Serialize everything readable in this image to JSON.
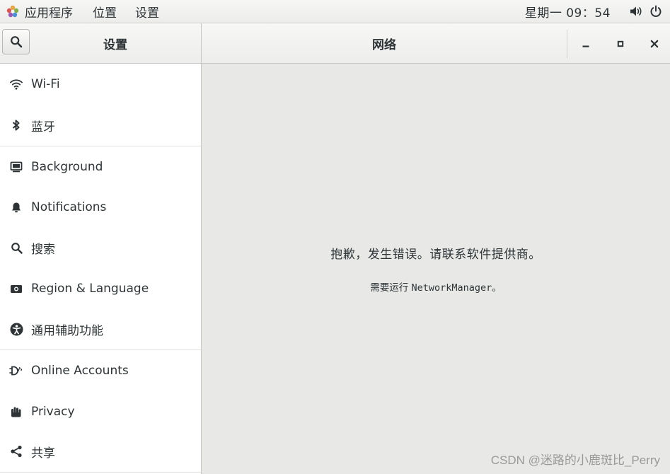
{
  "topbar": {
    "menus": [
      {
        "label": "应用程序"
      },
      {
        "label": "位置"
      },
      {
        "label": "设置"
      }
    ],
    "clock": "星期一 09：54"
  },
  "header": {
    "left_title": "设置",
    "center_title": "网络"
  },
  "sidebar": {
    "items": [
      {
        "label": "Wi-Fi",
        "icon": "wifi-icon"
      },
      {
        "label": "蓝牙",
        "icon": "bluetooth-icon"
      },
      {
        "label": "Background",
        "icon": "background-icon"
      },
      {
        "label": "Notifications",
        "icon": "bell-icon"
      },
      {
        "label": "搜索",
        "icon": "search-icon"
      },
      {
        "label": "Region & Language",
        "icon": "camera-icon"
      },
      {
        "label": "通用辅助功能",
        "icon": "accessibility-icon"
      },
      {
        "label": "Online Accounts",
        "icon": "online-accounts-icon"
      },
      {
        "label": "Privacy",
        "icon": "hand-icon"
      },
      {
        "label": "共享",
        "icon": "share-icon"
      }
    ]
  },
  "content": {
    "error_title": "抱歉，发生错误。请联系软件提供商。",
    "error_detail_prefix": "需要运行 ",
    "error_detail_program": "NetworkManager",
    "error_detail_suffix": "。"
  },
  "watermark": "CSDN @迷路的小鹿斑比_Perry"
}
